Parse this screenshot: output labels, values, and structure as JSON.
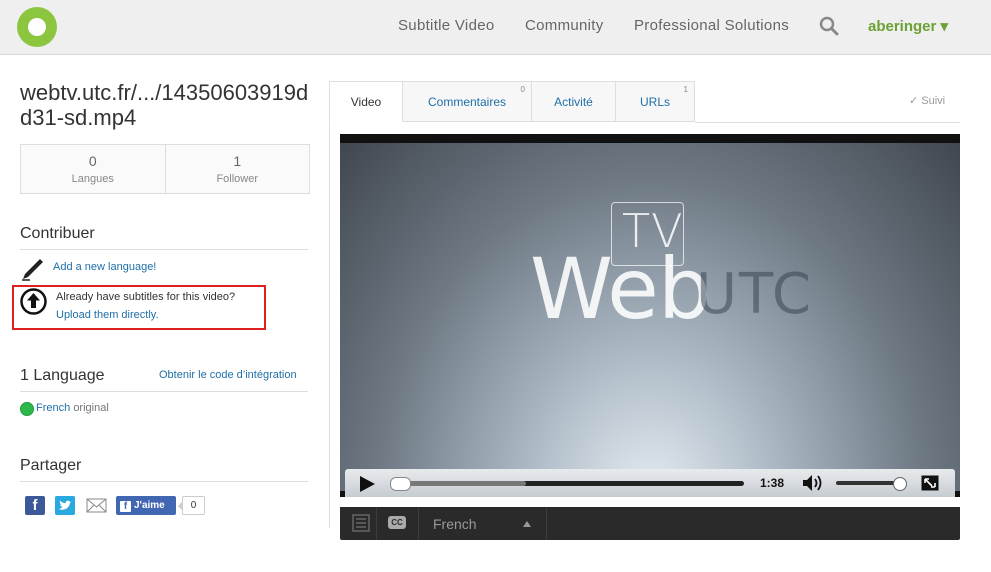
{
  "header": {
    "nav": [
      "Subtitle Video",
      "Community",
      "Professional Solutions"
    ],
    "user": "aberinger ▾"
  },
  "video": {
    "title": "webtv.utc.fr/.../14350603919dd31-sd.mp4",
    "stats": [
      {
        "value": "0",
        "label": "Langues"
      },
      {
        "value": "1",
        "label": "Follower"
      }
    ]
  },
  "contribute": {
    "heading": "Contribuer",
    "add_language": "Add a new language!",
    "upload_question": "Already have subtitles for this video?",
    "upload_link": "Upload them directly."
  },
  "languages": {
    "heading": "1 Language",
    "embed_link": "Obtenir le code d’intégration",
    "items": [
      {
        "name": "French",
        "note": "original",
        "status_color": "#2db84c"
      }
    ]
  },
  "share": {
    "heading": "Partager",
    "like_label": "J'aime",
    "like_count": "0"
  },
  "tabs": [
    {
      "label": "Video",
      "badge": ""
    },
    {
      "label": "Commentaires",
      "badge": "0"
    },
    {
      "label": "Activité",
      "badge": ""
    },
    {
      "label": "URLs",
      "badge": "1"
    }
  ],
  "follow": "✓ Suivi",
  "player": {
    "logo_tv": "TV",
    "logo_web": "Web",
    "logo_utc": "UTC",
    "time": "1:38",
    "progress_fraction": 0.38,
    "volume_fraction": 0.9,
    "subtitle_language": "French"
  },
  "colors": {
    "brand": "#8cc63f",
    "user": "#6ca233",
    "link": "#1f6fa8",
    "highlight_box": "#e02020"
  }
}
